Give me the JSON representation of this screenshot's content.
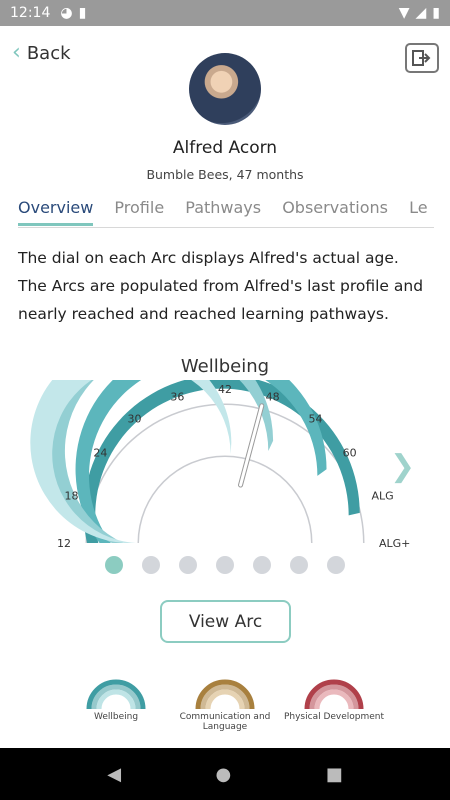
{
  "status_bar": {
    "time": "12:14",
    "icons": [
      "app-notification-icon",
      "sd-card-icon",
      "wifi-icon",
      "signal-icon",
      "battery-icon"
    ]
  },
  "header": {
    "back_label": "Back",
    "back_icon": "chevron-left-icon",
    "exit_icon": "logout-icon"
  },
  "child": {
    "name": "Alfred Acorn",
    "subtitle": "Bumble Bees, 47 months"
  },
  "tabs": [
    {
      "label": "Overview",
      "active": true
    },
    {
      "label": "Profile",
      "active": false
    },
    {
      "label": "Pathways",
      "active": false
    },
    {
      "label": "Observations",
      "active": false
    },
    {
      "label": "Le",
      "active": false
    }
  ],
  "description": "The dial on each Arc displays Alfred's actual age. The Arcs are populated from Alfred's last profile and nearly reached and reached learning pathways.",
  "arc": {
    "title": "Wellbeing",
    "age_months": 47,
    "scale_labels": [
      "12",
      "18",
      "24",
      "30",
      "36",
      "42",
      "48",
      "54",
      "60",
      "ALG",
      "ALG+"
    ],
    "rings": [
      {
        "level": 0.93,
        "color": "#3f9da3"
      },
      {
        "level": 0.8,
        "color": "#5cb6bc"
      },
      {
        "level": 0.64,
        "color": "#93cfd3"
      },
      {
        "level": 0.52,
        "color": "#c3e7ea"
      }
    ],
    "next_icon": "chevron-right-icon"
  },
  "pager": {
    "count": 7,
    "active_index": 0
  },
  "view_arc_label": "View Arc",
  "mini_arcs": [
    {
      "label": "Wellbeing",
      "color": "#3f9da3",
      "light": "#bfe4e6"
    },
    {
      "label": "Communication and Language",
      "color": "#a8803e",
      "light": "#e6d3b3"
    },
    {
      "label": "Physical Development",
      "color": "#b0404a",
      "light": "#eab9bd"
    }
  ],
  "nav": {
    "back": "nav-back-icon",
    "home": "nav-home-icon",
    "recents": "nav-recents-icon"
  }
}
